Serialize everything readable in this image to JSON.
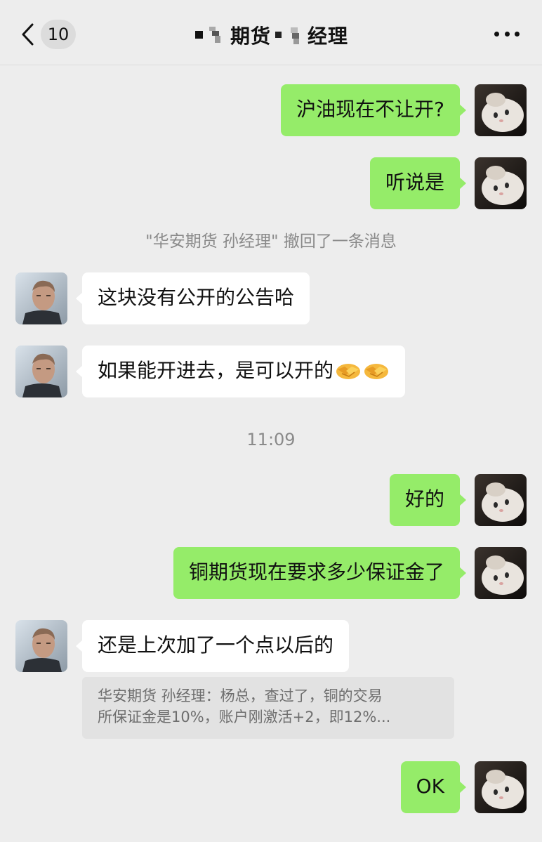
{
  "header": {
    "back_count": "10",
    "title_part1": "期货",
    "title_part2": "经理",
    "back_icon": "chevron-left-icon",
    "more_icon": "more-dots-icon"
  },
  "messages": [
    {
      "from": "me",
      "text": "沪油现在不让开?"
    },
    {
      "from": "me",
      "text": "听说是"
    },
    {
      "from": "system",
      "text": "\"华安期货 孙经理\" 撤回了一条消息"
    },
    {
      "from": "other",
      "text": "这块没有公开的公告哈"
    },
    {
      "from": "other",
      "text": "如果能开进去，是可以开的"
    },
    {
      "from": "system",
      "text": "11:09"
    },
    {
      "from": "me",
      "text": "好的"
    },
    {
      "from": "me",
      "text": "铜期货现在要求多少保证金了"
    },
    {
      "from": "other",
      "text": "还是上次加了一个点以后的"
    },
    {
      "from": "me",
      "text": "OK"
    }
  ],
  "quote": {
    "line1": "华安期货 孙经理：杨总，查过了，铜的交易",
    "line2": "所保证金是10%，账户刚激活+2，即12%..."
  },
  "colors": {
    "background": "#ededed",
    "my_bubble": "#95ec69",
    "other_bubble": "#ffffff",
    "system_text": "#8a8a8a"
  }
}
